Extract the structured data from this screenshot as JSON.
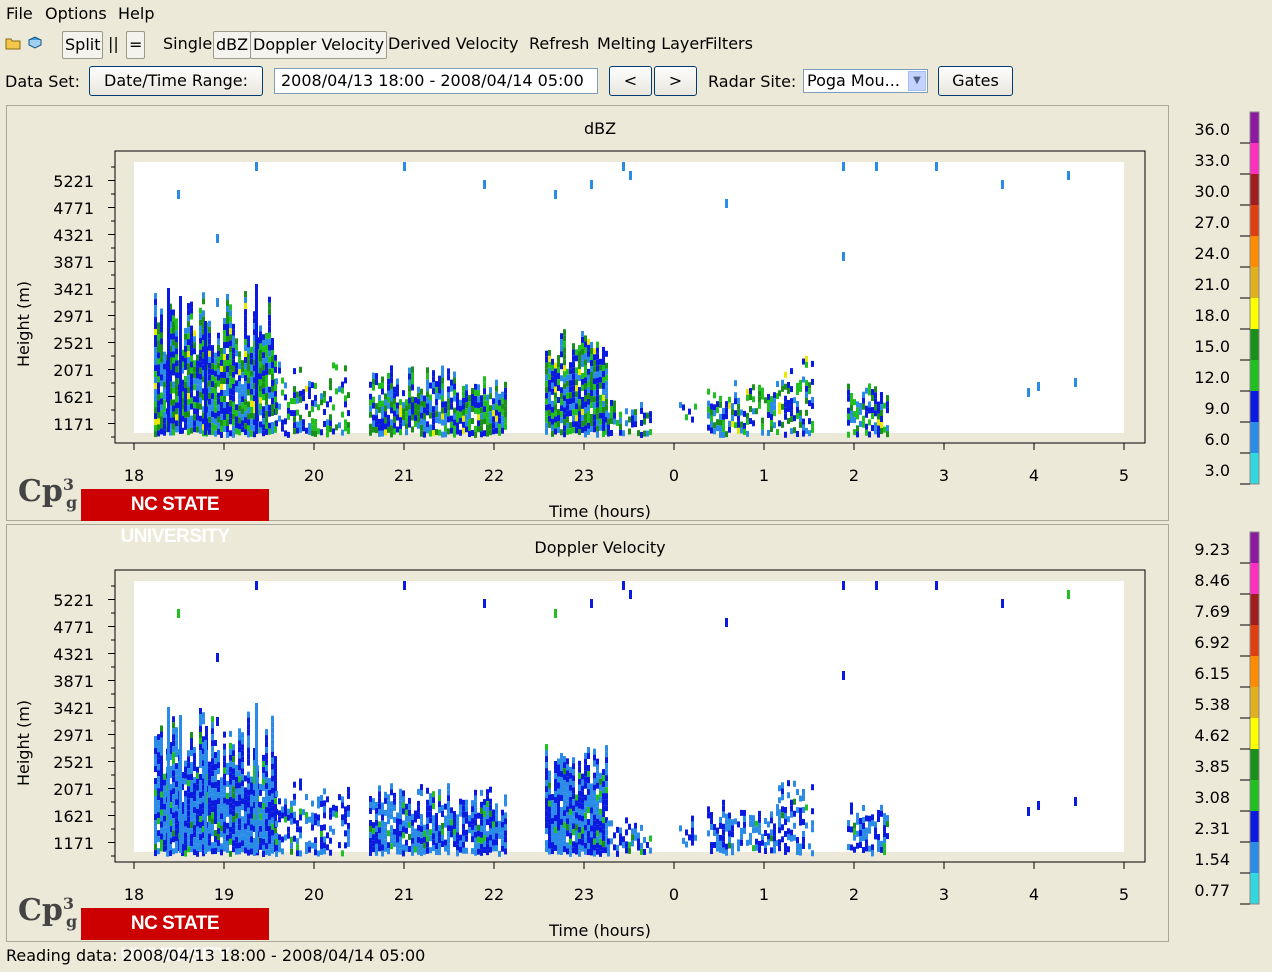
{
  "menu": {
    "file": "File",
    "options": "Options",
    "help": "Help"
  },
  "toolbar": {
    "split": "Split",
    "vsep": "||",
    "hsep": "=",
    "single": "Single",
    "dbz": "dBZ",
    "doppler": "Doppler Velocity",
    "derived": "Derived Velocity",
    "refresh": "Refresh",
    "melting": "Melting Layer",
    "filters": "Filters"
  },
  "dataset": {
    "label": "Data Set:",
    "date_button": "Date/Time Range:",
    "range": "2008/04/13 18:00 - 2008/04/14 05:00",
    "prev": "<",
    "next": ">",
    "radar_label": "Radar Site:",
    "radar_value": "Poga Mou...",
    "gates": "Gates"
  },
  "colors": {
    "plot_bg": "#ffffff",
    "blue_dark": "#0a1adf",
    "blue_light": "#2b8ce8",
    "green": "#20c020",
    "green_dark": "#1a8f1a",
    "yellow": "#e8e800"
  },
  "chart_data": [
    {
      "type": "heatmap",
      "title": "dBZ",
      "xlabel": "Time (hours)",
      "ylabel": "Height (m)",
      "x_ticks": [
        "18",
        "19",
        "20",
        "21",
        "22",
        "23",
        "0",
        "1",
        "2",
        "3",
        "4",
        "5"
      ],
      "y_ticks": [
        "1171",
        "1621",
        "2071",
        "2521",
        "2971",
        "3421",
        "3871",
        "4321",
        "4771",
        "5221"
      ],
      "colorbar": {
        "labels": [
          "36.0",
          "33.0",
          "30.0",
          "27.0",
          "24.0",
          "21.0",
          "18.0",
          "15.0",
          "12.0",
          "9.0",
          "6.0",
          "3.0"
        ],
        "colors": [
          "#8c1aa0",
          "#ff30c0",
          "#a01e1e",
          "#e04010",
          "#ff8c00",
          "#e0b020",
          "#ffff00",
          "#1a8f1a",
          "#20c020",
          "#0a1adf",
          "#2b8ce8",
          "#30d8e0"
        ]
      }
    },
    {
      "type": "heatmap",
      "title": "Doppler Velocity",
      "xlabel": "Time (hours)",
      "ylabel": "Height (m)",
      "x_ticks": [
        "18",
        "19",
        "20",
        "21",
        "22",
        "23",
        "0",
        "1",
        "2",
        "3",
        "4",
        "5"
      ],
      "y_ticks": [
        "1171",
        "1621",
        "2071",
        "2521",
        "2971",
        "3421",
        "3871",
        "4321",
        "4771",
        "5221"
      ],
      "colorbar": {
        "labels": [
          "9.23",
          "8.46",
          "7.69",
          "6.92",
          "6.15",
          "5.38",
          "4.62",
          "3.85",
          "3.08",
          "2.31",
          "1.54",
          "0.77"
        ],
        "colors": [
          "#8c1aa0",
          "#ff30c0",
          "#a01e1e",
          "#e04010",
          "#ff8c00",
          "#e0b020",
          "#ffff00",
          "#1a8f1a",
          "#20c020",
          "#0a1adf",
          "#2b8ce8",
          "#30d8e0"
        ]
      }
    }
  ],
  "logo": {
    "cpg": "Cp",
    "sup": "3",
    "sub": "g",
    "univ": "NC STATE UNIVERSITY"
  },
  "status": "Reading data: 2008/04/13 18:00 - 2008/04/14 05:00"
}
